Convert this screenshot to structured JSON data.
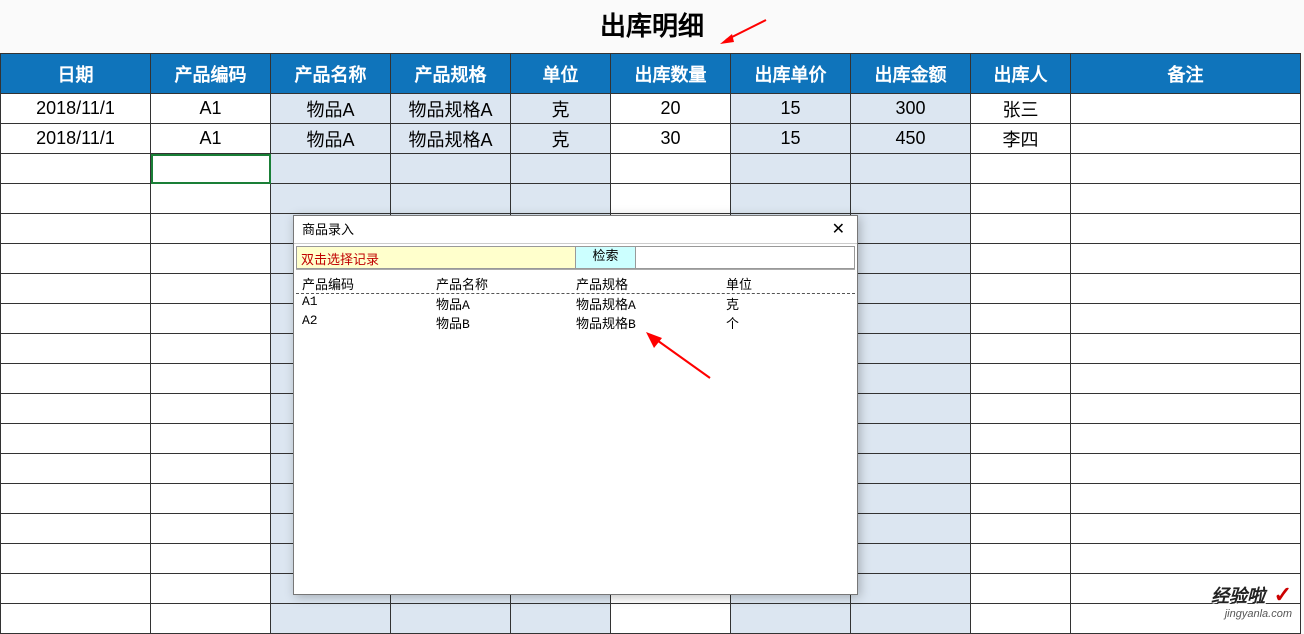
{
  "title": "出库明细",
  "columns": {
    "date": "日期",
    "code": "产品编码",
    "name": "产品名称",
    "spec": "产品规格",
    "unit": "单位",
    "qty": "出库数量",
    "price": "出库单价",
    "amount": "出库金额",
    "person": "出库人",
    "note": "备注"
  },
  "rows": [
    {
      "date": "2018/11/1",
      "code": "A1",
      "name": "物品A",
      "spec": "物品规格A",
      "unit": "克",
      "qty": "20",
      "price": "15",
      "amount": "300",
      "person": "张三",
      "note": ""
    },
    {
      "date": "2018/11/1",
      "code": "A1",
      "name": "物品A",
      "spec": "物品规格A",
      "unit": "克",
      "qty": "30",
      "price": "15",
      "amount": "450",
      "person": "李四",
      "note": ""
    }
  ],
  "blank_row_count": 16,
  "dialog": {
    "title": "商品录入",
    "close": "✕",
    "hint": "双击选择记录",
    "search_btn": "检索",
    "search_value": "",
    "headers": {
      "code": "产品编码",
      "name": "产品名称",
      "spec": "产品规格",
      "unit": "单位"
    },
    "items": [
      {
        "code": "A1",
        "name": "物品A",
        "spec": "物品规格A",
        "unit": "克"
      },
      {
        "code": "A2",
        "name": "物品B",
        "spec": "物品规格B",
        "unit": "个"
      }
    ]
  },
  "watermark": {
    "main": "经验啦",
    "check": "✓",
    "sub": "jingyanla.com"
  }
}
